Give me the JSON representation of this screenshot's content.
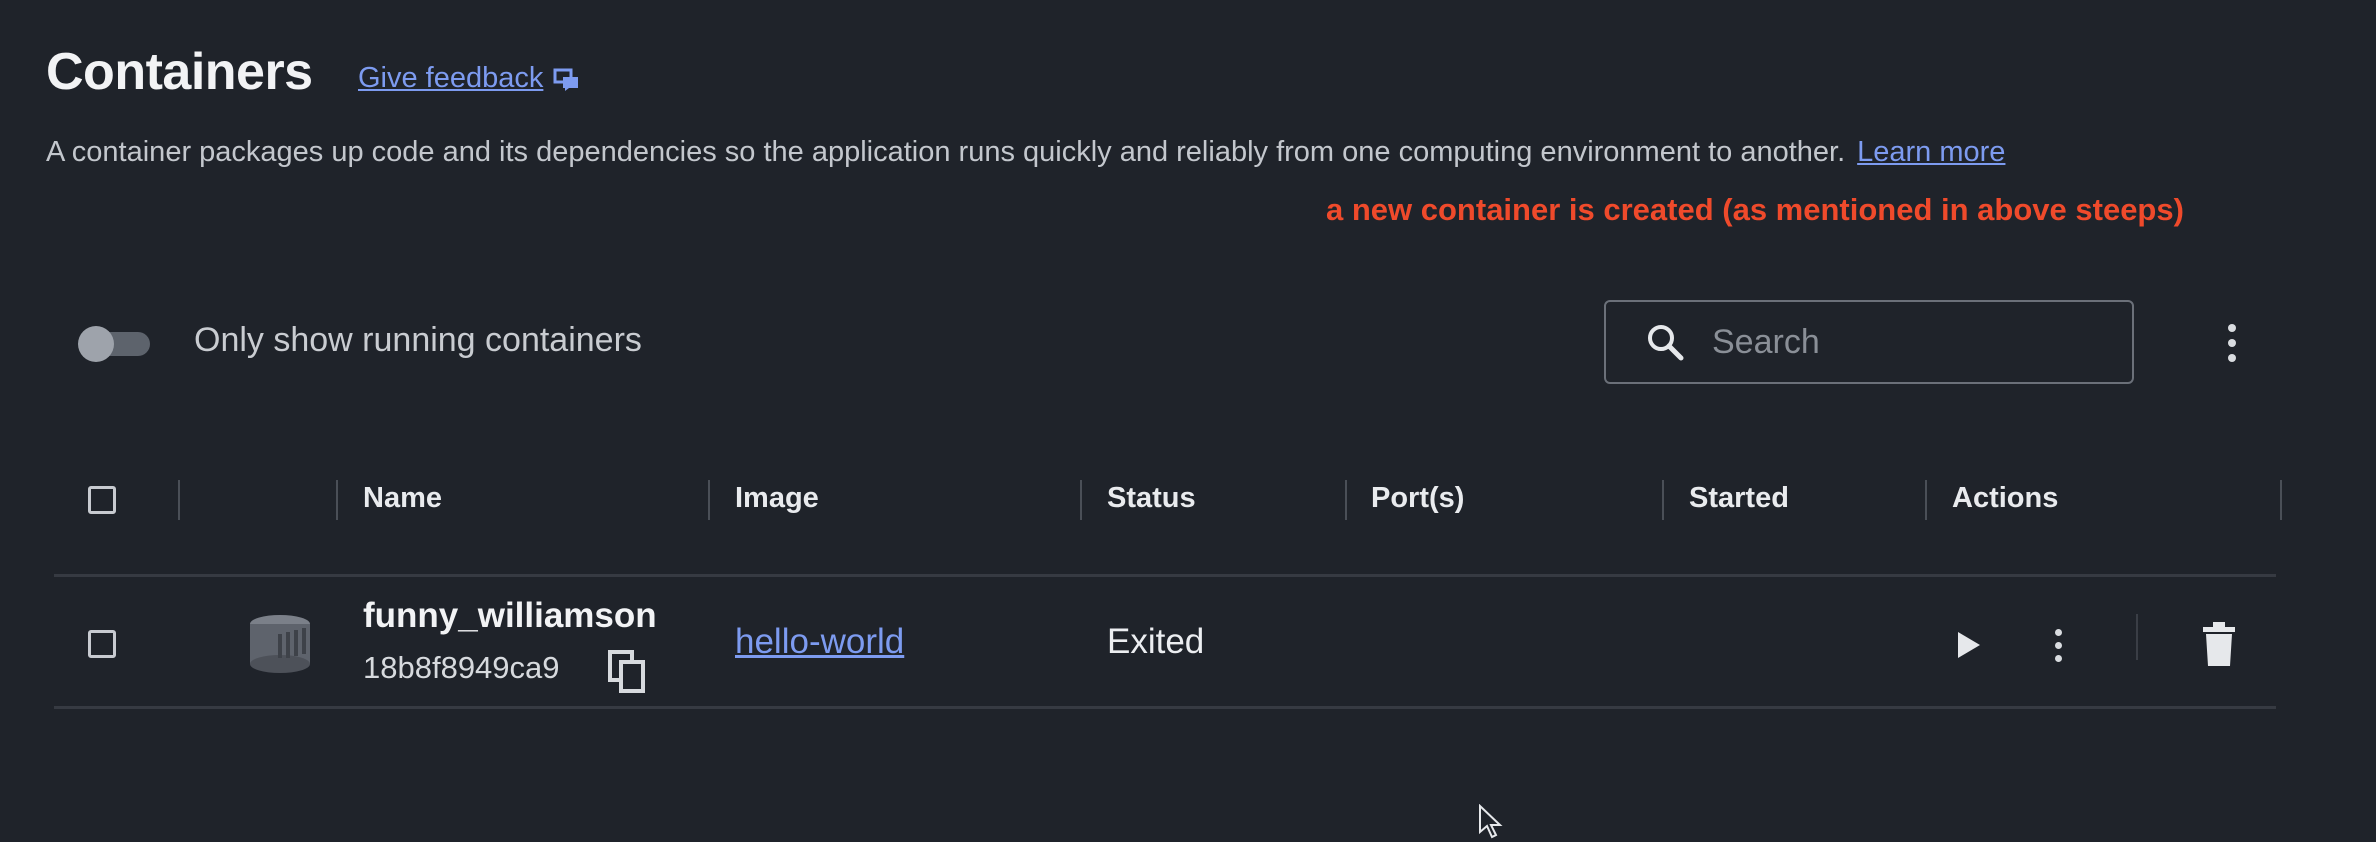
{
  "header": {
    "title": "Containers",
    "feedback_label": "Give feedback",
    "description": "A container packages up code and its dependencies so the application runs quickly and reliably from one computing environment to another.",
    "learn_more_label": "Learn more"
  },
  "annotation": "a new container is created (as mentioned in above steeps)",
  "filters": {
    "running_only_label": "Only show running containers",
    "running_only_on": false,
    "search_placeholder": "Search"
  },
  "table": {
    "columns": [
      "Name",
      "Image",
      "Status",
      "Port(s)",
      "Started",
      "Actions"
    ],
    "rows": [
      {
        "name": "funny_williamson",
        "id": "18b8f8949ca9",
        "image": "hello-world",
        "status": "Exited",
        "ports": "",
        "started": ""
      }
    ]
  },
  "icons": {
    "feedback": "feedback-icon",
    "search": "search-icon",
    "more": "more-vertical-icon",
    "container": "container-icon",
    "copy": "copy-icon",
    "play": "play-icon",
    "delete": "trash-icon",
    "cursor": "mouse-cursor-icon"
  },
  "colors": {
    "background": "#1f232a",
    "link": "#7d9bf0",
    "annotation": "#ef4a2b"
  }
}
